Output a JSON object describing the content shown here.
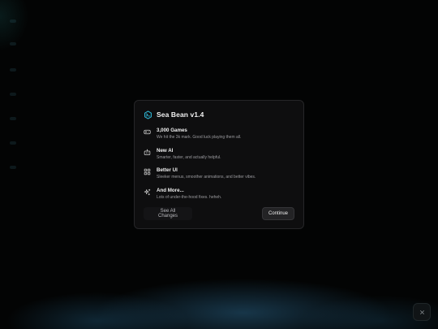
{
  "modal": {
    "title": "Sea Bean v1.4",
    "brand_icon": "sea-bean-logo",
    "accent_color": "#2fb8d6",
    "features": [
      {
        "icon": "gamepad-icon",
        "title": "3,000 Games",
        "description": "We hit the 3k mark. Good luck playing them all."
      },
      {
        "icon": "bot-icon",
        "title": "New AI",
        "description": "Smarter, faster, and actually helpful."
      },
      {
        "icon": "layout-grid-icon",
        "title": "Better UI",
        "description": "Sleeker menus, smoother animations, and better vibes."
      },
      {
        "icon": "sparkles-icon",
        "title": "And More...",
        "description": "Lots of under-the-hood fixes. heheh."
      }
    ],
    "secondary_button": "See All Changes",
    "primary_button": "Continue"
  },
  "close_fab": {
    "icon": "close-icon"
  }
}
